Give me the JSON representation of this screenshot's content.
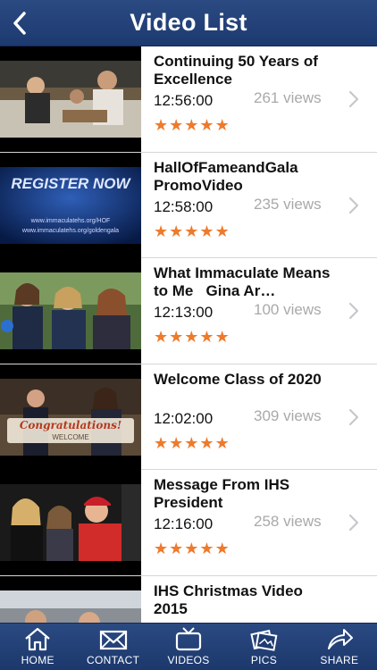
{
  "header": {
    "title": "Video List",
    "back_icon": "back-chevron-icon"
  },
  "videos": [
    {
      "title": "Continuing 50 Years of Excellence",
      "duration": "12:56:00",
      "views": "261 views",
      "rating": 5
    },
    {
      "title": "HallOfFameandGala PromoVideo",
      "duration": "12:58:00",
      "views": "235 views",
      "rating": 5,
      "thumb_text": {
        "headline": "REGISTER NOW",
        "line1": "www.immaculatehs.org/HOF",
        "line2": "www.immaculatehs.org/goldengala"
      }
    },
    {
      "title": "What Immaculate Means to Me   Gina Ar…",
      "duration": "12:13:00",
      "views": "100 views",
      "rating": 5
    },
    {
      "title": "Welcome Class of 2020",
      "duration": "12:02:00",
      "views": "309 views",
      "rating": 5,
      "thumb_text": {
        "headline": "Congratulations!",
        "line1": "WELCOME"
      }
    },
    {
      "title": "Message From IHS President",
      "duration": "12:16:00",
      "views": "258 views",
      "rating": 5
    },
    {
      "title": "IHS Christmas Video 2015",
      "duration": "",
      "views": "",
      "rating": 0
    }
  ],
  "tabbar": [
    {
      "label": "HOME",
      "icon": "home-icon"
    },
    {
      "label": "CONTACT",
      "icon": "envelope-icon"
    },
    {
      "label": "VIDEOS",
      "icon": "tv-icon"
    },
    {
      "label": "PICS",
      "icon": "photos-icon"
    },
    {
      "label": "SHARE",
      "icon": "share-icon"
    }
  ],
  "colors": {
    "nav": "#1d3a70",
    "star": "#ee7a2c",
    "views": "#a9a9a9"
  }
}
